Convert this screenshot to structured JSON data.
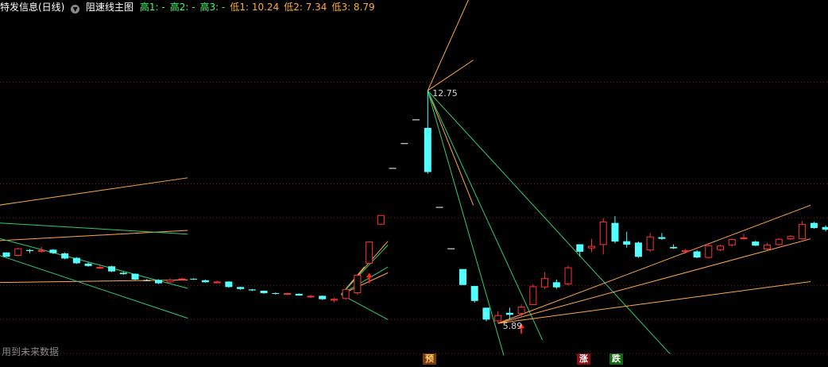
{
  "header": {
    "title": "特发信息(日线)",
    "indicator_name": "阻速线主图",
    "items": [
      {
        "label": "高1",
        "value": "-",
        "color": "#33ff66"
      },
      {
        "label": "高2",
        "value": "-",
        "color": "#33ff66"
      },
      {
        "label": "高3",
        "value": "-",
        "color": "#33ff66"
      },
      {
        "label": "低1",
        "value": "10.24",
        "color": "#ffaa33"
      },
      {
        "label": "低2",
        "value": "7.34",
        "color": "#ffaa33"
      },
      {
        "label": "低3",
        "value": "8.79",
        "color": "#ffaa33"
      }
    ]
  },
  "footer_note": "用到未来数据",
  "markers": [
    {
      "text": "预",
      "bg": "#7a3a10",
      "fg": "#ffcc66"
    },
    {
      "text": "涨",
      "bg": "#8a1010",
      "fg": "#ffffff"
    },
    {
      "text": "跌",
      "bg": "#106a10",
      "fg": "#ffffff"
    }
  ],
  "chart_data": {
    "type": "candlestick",
    "ylim": [
      5.0,
      15.0
    ],
    "grid": true,
    "annotations": [
      {
        "text": "12.75",
        "bar": 36,
        "price": 12.75
      },
      {
        "text": "5.89",
        "bar": 42,
        "price": 5.89
      }
    ],
    "colors": {
      "up": "#ff3232",
      "down": "#54ffff",
      "flat": "#ffffff",
      "fan_high": "#ffaa44",
      "fan_low": "#2ecc71"
    },
    "candles": [
      [
        7.98,
        7.98,
        7.85,
        7.85
      ],
      [
        7.88,
        8.12,
        7.86,
        8.1
      ],
      [
        8.05,
        8.08,
        7.96,
        8.02
      ],
      [
        8.0,
        8.15,
        7.98,
        8.05
      ],
      [
        8.06,
        8.08,
        7.93,
        7.96
      ],
      [
        7.95,
        7.98,
        7.78,
        7.8
      ],
      [
        7.82,
        7.84,
        7.64,
        7.66
      ],
      [
        7.65,
        7.68,
        7.56,
        7.58
      ],
      [
        7.52,
        7.6,
        7.5,
        7.55
      ],
      [
        7.57,
        7.59,
        7.4,
        7.42
      ],
      [
        7.38,
        7.41,
        7.32,
        7.34
      ],
      [
        7.35,
        7.36,
        7.16,
        7.18
      ],
      [
        7.16,
        7.19,
        7.14,
        7.16
      ],
      [
        7.17,
        7.19,
        7.05,
        7.07
      ],
      [
        7.1,
        7.21,
        7.08,
        7.18
      ],
      [
        7.17,
        7.23,
        7.15,
        7.21
      ],
      [
        7.2,
        7.22,
        7.17,
        7.18
      ],
      [
        7.16,
        7.18,
        7.09,
        7.1
      ],
      [
        7.11,
        7.15,
        7.07,
        7.12
      ],
      [
        7.12,
        7.13,
        6.94,
        6.96
      ],
      [
        6.96,
        6.97,
        6.88,
        6.9
      ],
      [
        6.89,
        6.9,
        6.84,
        6.86
      ],
      [
        6.85,
        6.86,
        6.76,
        6.78
      ],
      [
        6.78,
        6.8,
        6.74,
        6.76
      ],
      [
        6.76,
        6.79,
        6.73,
        6.78
      ],
      [
        6.76,
        6.77,
        6.7,
        6.71
      ],
      [
        6.66,
        6.73,
        6.64,
        6.7
      ],
      [
        6.7,
        6.71,
        6.58,
        6.6
      ],
      [
        6.56,
        6.64,
        6.51,
        6.61
      ],
      [
        6.61,
        6.91,
        6.58,
        6.9
      ],
      [
        6.78,
        7.34,
        6.73,
        7.32
      ],
      [
        7.65,
        8.3,
        7.65,
        8.3
      ],
      [
        8.8,
        9.08,
        8.8,
        9.08
      ],
      [
        10.47,
        10.47,
        10.47,
        10.47
      ],
      [
        11.2,
        11.2,
        11.2,
        11.2
      ],
      [
        11.9,
        11.9,
        11.9,
        11.9
      ],
      [
        11.65,
        12.75,
        10.3,
        10.35
      ],
      [
        9.32,
        9.32,
        9.32,
        9.32
      ],
      [
        8.1,
        8.1,
        8.1,
        8.1
      ],
      [
        7.49,
        7.49,
        7.02,
        7.02
      ],
      [
        6.99,
        6.99,
        6.5,
        6.55
      ],
      [
        6.35,
        6.35,
        5.95,
        6.0
      ],
      [
        5.95,
        6.25,
        5.89,
        6.13
      ],
      [
        6.2,
        6.35,
        6.0,
        6.14
      ],
      [
        6.17,
        6.45,
        6.1,
        6.38
      ],
      [
        6.43,
        7.04,
        6.43,
        6.98
      ],
      [
        6.95,
        7.4,
        6.9,
        7.22
      ],
      [
        7.1,
        7.18,
        6.9,
        6.95
      ],
      [
        7.04,
        7.59,
        7.0,
        7.54
      ],
      [
        8.22,
        8.22,
        7.85,
        8.0
      ],
      [
        8.1,
        8.38,
        7.99,
        8.17
      ],
      [
        8.2,
        8.99,
        7.92,
        8.89
      ],
      [
        8.85,
        9.05,
        8.25,
        8.3
      ],
      [
        8.31,
        8.59,
        8.12,
        8.21
      ],
      [
        8.27,
        8.3,
        7.82,
        7.85
      ],
      [
        8.04,
        8.55,
        8.0,
        8.45
      ],
      [
        8.43,
        8.55,
        8.35,
        8.38
      ],
      [
        8.14,
        8.22,
        8.08,
        8.1
      ],
      [
        8.0,
        8.08,
        7.95,
        8.04
      ],
      [
        8.01,
        8.05,
        7.81,
        7.83
      ],
      [
        7.82,
        8.23,
        7.8,
        8.19
      ],
      [
        8.05,
        8.2,
        8.02,
        8.18
      ],
      [
        8.19,
        8.39,
        8.15,
        8.37
      ],
      [
        8.4,
        8.53,
        8.36,
        8.42
      ],
      [
        8.3,
        8.32,
        8.17,
        8.18
      ],
      [
        8.07,
        8.26,
        8.04,
        8.21
      ],
      [
        8.2,
        8.4,
        8.18,
        8.38
      ],
      [
        8.37,
        8.49,
        8.35,
        8.46
      ],
      [
        8.37,
        8.9,
        8.35,
        8.82
      ],
      [
        8.85,
        8.88,
        8.68,
        8.7
      ],
      [
        8.73,
        8.78,
        8.6,
        8.65
      ]
    ],
    "fans": [
      {
        "from": [
          -3.1,
          9.25
        ],
        "to": [
          15.5,
          10.18
        ],
        "color": "#ffaa44"
      },
      {
        "from": [
          -3.1,
          8.28
        ],
        "to": [
          15.5,
          8.63
        ],
        "color": "#ffaa44"
      },
      {
        "from": [
          -3.1,
          7.08
        ],
        "to": [
          15.5,
          7.17
        ],
        "color": "#ffaa44"
      },
      {
        "from": [
          -3.1,
          8.9
        ],
        "to": [
          15.5,
          8.52
        ],
        "color": "#2ecc71"
      },
      {
        "from": [
          -3.1,
          8.62
        ],
        "to": [
          15.5,
          6.92
        ],
        "color": "#2ecc71"
      },
      {
        "from": [
          -3.1,
          8.18
        ],
        "to": [
          15.5,
          6.04
        ],
        "color": "#2ecc71"
      },
      {
        "from": [
          28.6,
          6.74
        ],
        "to": [
          30.6,
          7.56
        ],
        "color": "#ffaa44"
      },
      {
        "from": [
          28.6,
          6.74
        ],
        "to": [
          32.6,
          8.31
        ],
        "color": "#ffaa44"
      },
      {
        "from": [
          28.6,
          6.74
        ],
        "to": [
          32.6,
          7.38
        ],
        "color": "#ffaa44"
      },
      {
        "from": [
          28.6,
          6.74
        ],
        "to": [
          32.6,
          7.55
        ],
        "color": "#2ecc71"
      },
      {
        "from": [
          28.6,
          6.74
        ],
        "to": [
          32.6,
          8.2
        ],
        "color": "#2ecc71"
      },
      {
        "from": [
          28.6,
          6.74
        ],
        "to": [
          32.6,
          6.0
        ],
        "color": "#2ecc71"
      },
      {
        "from": [
          36.0,
          12.75
        ],
        "to": [
          39.9,
          15.75
        ],
        "color": "#ffaa44"
      },
      {
        "from": [
          36.0,
          12.75
        ],
        "to": [
          39.9,
          13.65
        ],
        "color": "#ffaa44"
      },
      {
        "from": [
          36.0,
          12.75
        ],
        "to": [
          39.9,
          9.37
        ],
        "color": "#ffaa44"
      },
      {
        "from": [
          36.0,
          12.75
        ],
        "to": [
          56.7,
          4.99
        ],
        "color": "#2ecc71"
      },
      {
        "from": [
          36.0,
          12.75
        ],
        "to": [
          45.8,
          5.4
        ],
        "color": "#2ecc71"
      },
      {
        "from": [
          36.0,
          12.75
        ],
        "to": [
          42.5,
          4.94
        ],
        "color": "#2ecc71"
      },
      {
        "from": [
          42.0,
          5.89
        ],
        "to": [
          68.7,
          9.37
        ],
        "color": "#ffaa44"
      },
      {
        "from": [
          42.0,
          5.89
        ],
        "to": [
          68.7,
          8.38
        ],
        "color": "#ffaa44"
      },
      {
        "from": [
          42.0,
          5.89
        ],
        "to": [
          68.7,
          7.12
        ],
        "color": "#ffaa44"
      }
    ],
    "arrows": [
      {
        "bar": 31,
        "price": 7.38
      },
      {
        "bar": 44,
        "price": 5.89
      }
    ]
  }
}
